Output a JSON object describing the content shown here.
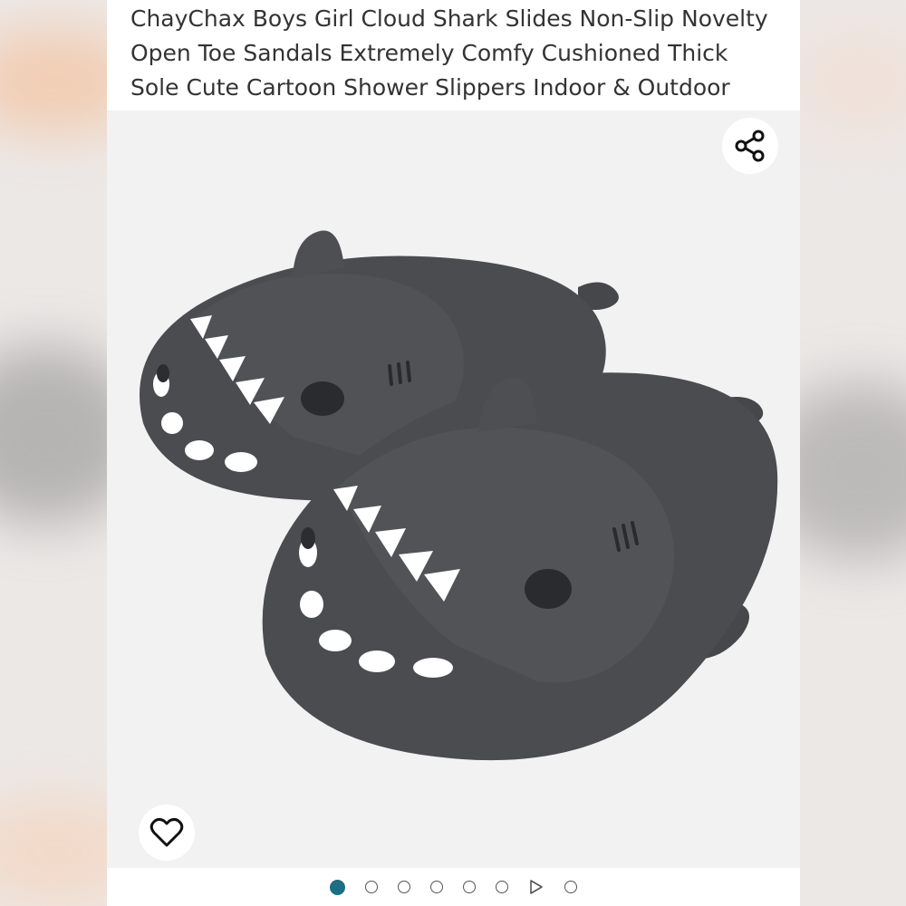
{
  "product": {
    "title": "ChayChax Boys Girl Cloud Shark Slides Non-Slip Novelty Open Toe Sandals Extremely Comfy Cushioned Thick Sole Cute Cartoon Shower Slippers Indoor & Outdoor"
  },
  "gallery": {
    "share_icon": "share-icon",
    "wishlist_icon": "heart-outline-icon",
    "image_subject": "dark grey shark slides",
    "indicators": [
      {
        "type": "dot",
        "active": true
      },
      {
        "type": "dot",
        "active": false
      },
      {
        "type": "dot",
        "active": false
      },
      {
        "type": "dot",
        "active": false
      },
      {
        "type": "dot",
        "active": false
      },
      {
        "type": "dot",
        "active": false
      },
      {
        "type": "video",
        "active": false
      },
      {
        "type": "dot",
        "active": false
      }
    ]
  },
  "colors": {
    "accent": "#1a6f86",
    "slipper": "#4a4c50",
    "teeth": "#ffffff"
  }
}
